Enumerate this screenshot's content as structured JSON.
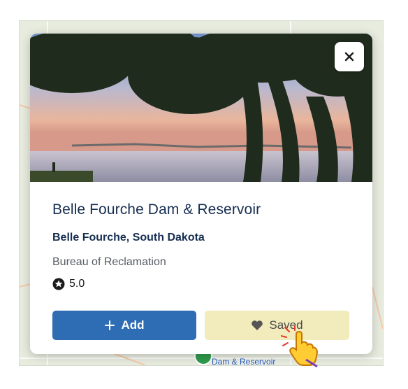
{
  "card": {
    "title": "Belle Fourche Dam & Reservoir",
    "location": "Belle Fourche, South Dakota",
    "agency": "Bureau of Reclamation",
    "rating": "5.0",
    "close_icon": "close-icon",
    "star_icon": "star-badge-icon"
  },
  "actions": {
    "add_label": "Add",
    "add_icon": "plus-icon",
    "saved_label": "Saved",
    "saved_icon": "heart-icon"
  },
  "map": {
    "marker_label": "Dam & Reservoir"
  },
  "colors": {
    "title_navy": "#162e51",
    "primary_blue": "#2e6db4",
    "saved_bg": "#f2ebbc",
    "highlight_yellow": "#f0e296"
  }
}
